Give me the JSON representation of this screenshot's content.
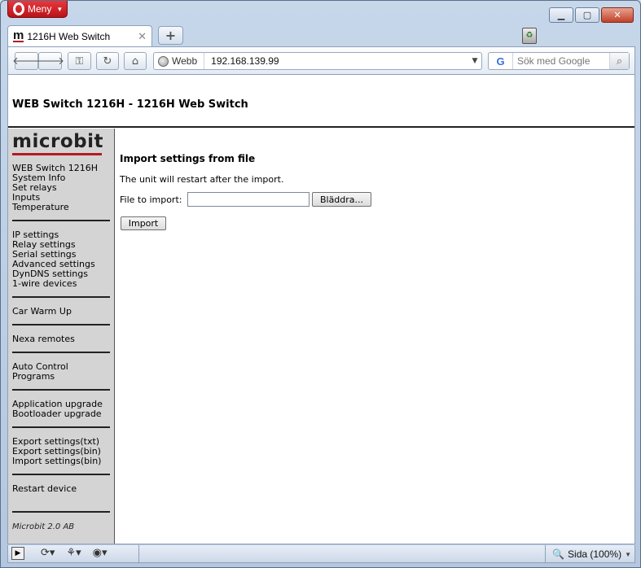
{
  "browser": {
    "menu_label": "Meny",
    "tab_title": "1216H Web Switch",
    "tab_favicon": "m",
    "address_mode": "Webb",
    "url": "192.168.139.99",
    "search_placeholder": "Sök med Google",
    "search_engine_glyph": "G",
    "zoom_label": "Sida (100%)"
  },
  "page": {
    "header_title": "WEB Switch 1216H - 1216H Web Switch",
    "logo_text": "microbit",
    "sidebar": {
      "group1": [
        "WEB Switch 1216H",
        "System Info",
        "Set relays",
        "Inputs",
        "Temperature"
      ],
      "group2": [
        "IP settings",
        "Relay settings",
        "Serial settings",
        "Advanced settings",
        "DynDNS settings",
        "1-wire devices"
      ],
      "group3": [
        "Car Warm Up"
      ],
      "group4": [
        "Nexa remotes"
      ],
      "group5": [
        "Auto Control",
        "Programs"
      ],
      "group6": [
        "Application upgrade",
        "Bootloader upgrade"
      ],
      "group7": [
        "Export settings(txt)",
        "Export settings(bin)",
        "Import settings(bin)"
      ],
      "group8": [
        "Restart device"
      ],
      "footer": "Microbit 2.0 AB"
    },
    "content": {
      "heading": "Import settings from file",
      "note": "The unit will restart after the import.",
      "file_label": "File to import:",
      "browse_label": "Bläddra...",
      "import_label": "Import"
    }
  },
  "colors": {
    "accent_red": "#b01c22",
    "sidebar_bg": "#d4d4d4"
  }
}
